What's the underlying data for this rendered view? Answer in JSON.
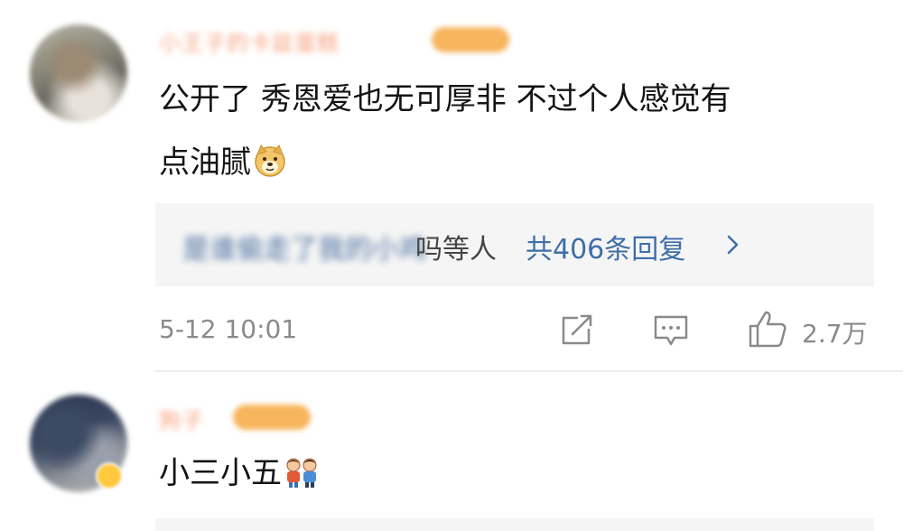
{
  "comments": [
    {
      "username": "小王子的卡兹蛋糕",
      "text_line1": "公开了 秀恩爱也无可厚非 不过个人感觉有",
      "text_line2": "点油腻",
      "emoji": "doge-emoji",
      "reply_names": "是谁偷走了我的小鸡",
      "reply_who": "吗等人",
      "reply_count": "共406条回复",
      "timestamp": "5-12 10:01",
      "likes": "2.7万"
    },
    {
      "username": "狗子",
      "text": "小三小五",
      "emoji": "kids-emoji"
    }
  ],
  "colors": {
    "link_blue": "#3f6ea8",
    "meta_gray": "#8a8a8a",
    "reply_bg": "#f5f5f5"
  }
}
